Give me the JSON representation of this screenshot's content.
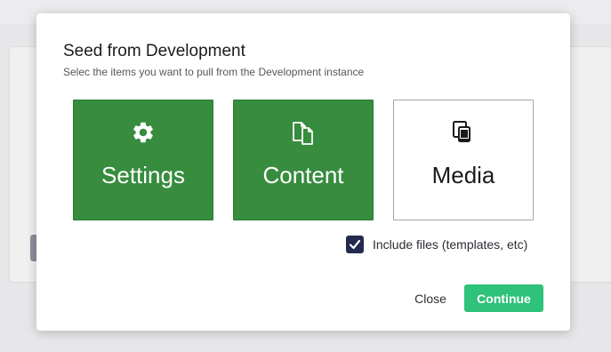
{
  "modal": {
    "title": "Seed from Development",
    "subtitle": "Selec the items you want to pull from the Development instance"
  },
  "options": [
    {
      "label": "Settings",
      "icon": "gear-icon",
      "selected": true
    },
    {
      "label": "Content",
      "icon": "documents-icon",
      "selected": true
    },
    {
      "label": "Media",
      "icon": "devices-icon",
      "selected": false
    }
  ],
  "include_files": {
    "label": "Include files (templates, etc)",
    "checked": true
  },
  "footer": {
    "close_label": "Close",
    "continue_label": "Continue"
  },
  "colors": {
    "selected_tile": "#378c3e",
    "continue_button": "#2ec27a",
    "checkbox": "#232a4d"
  }
}
